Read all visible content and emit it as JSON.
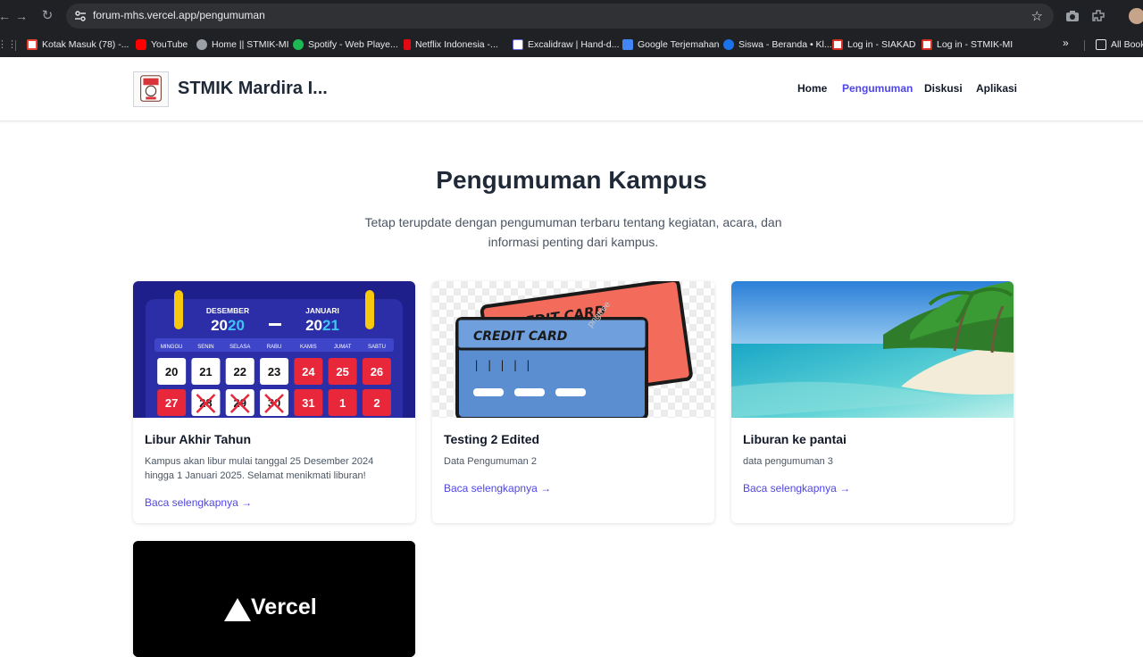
{
  "browser": {
    "url_host": "forum-mhs.vercel.app",
    "url_path": "/pengumuman",
    "bookmarks": [
      {
        "label": "Kotak Masuk (78) -...",
        "color": "#ea4335"
      },
      {
        "label": "YouTube",
        "color": "#ff0000"
      },
      {
        "label": "Home || STMIK-MI",
        "color": "#9aa0a6"
      },
      {
        "label": "Spotify - Web Playe...",
        "color": "#1db954"
      },
      {
        "label": "Netflix Indonesia -...",
        "color": "#e50914"
      },
      {
        "label": "Excalidraw | Hand-d...",
        "color": "#6965db"
      },
      {
        "label": "Google Terjemahan",
        "color": "#4285f4"
      },
      {
        "label": "Siswa - Beranda • Kl...",
        "color": "#1a73e8"
      },
      {
        "label": "Log in - SIAKAD",
        "color": "#d93025"
      },
      {
        "label": "Log in - STMIK-MI",
        "color": "#d93025"
      }
    ],
    "all_bookmarks": "All Book"
  },
  "header": {
    "brand": "STMIK Mardira I...",
    "nav": [
      "Home",
      "Pengumuman",
      "Diskusi",
      "Aplikasi"
    ],
    "active": "Pengumuman"
  },
  "main": {
    "title": "Pengumuman Kampus",
    "subtitle": "Tetap terupdate dengan pengumuman terbaru tentang kegiatan, acara, dan informasi penting dari kampus.",
    "cards": [
      {
        "title": "Libur Akhir Tahun",
        "text": "Kampus akan libur mulai tanggal 25 Desember 2024 hingga 1 Januari 2025. Selamat menikmati liburan!",
        "link": "Baca selengkapnya →",
        "image": {
          "month_left": "DESEMBER",
          "month_right": "JANUARI",
          "year_left_a": "20",
          "year_left_b": "20",
          "year_right_a": "20",
          "year_right_b": "21",
          "days": [
            "MINGGU",
            "SENIN",
            "SELASA",
            "RABU",
            "KAMIS",
            "JUMAT",
            "SABTU"
          ],
          "row1": [
            "20",
            "21",
            "22",
            "23",
            "24",
            "25",
            "26"
          ],
          "row2": [
            "27",
            "28",
            "29",
            "30",
            "31",
            "1",
            "2"
          ]
        }
      },
      {
        "title": "Testing 2 Edited",
        "text": "Data Pengumuman 2",
        "link": "Baca selengkapnya →",
        "image": {
          "back_label": "CREDIT CARD",
          "front_label": "CREDIT CARD",
          "digits": "| | | | |",
          "watermark": "pngtree"
        }
      },
      {
        "title": "Liburan ke pantai",
        "text": "data pengumuman 3",
        "link": "Baca selengkapnya →"
      },
      {
        "image": {
          "brand": "Vercel"
        }
      }
    ]
  },
  "colors": {
    "accent": "#4f46e5",
    "calendar_bg": "#1e1f8a",
    "calendar_red": "#e8283a",
    "card_red": "#f26b5b",
    "card_blue": "#5b8ed1"
  }
}
